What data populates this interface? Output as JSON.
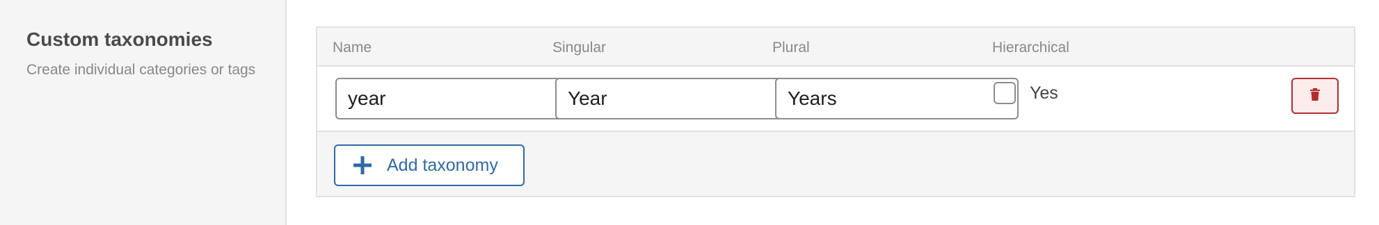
{
  "sidebar": {
    "title": "Custom taxonomies",
    "description": "Create individual categories or tags"
  },
  "table": {
    "headers": {
      "name": "Name",
      "singular": "Singular",
      "plural": "Plural",
      "hierarchical": "Hierarchical"
    },
    "rows": [
      {
        "name": "year",
        "singular": "Year",
        "plural": "Years",
        "hierarchical_label": "Yes",
        "hierarchical_checked": false
      }
    ]
  },
  "actions": {
    "add_label": "Add taxonomy",
    "delete_icon": "trash-icon",
    "add_icon": "plus-icon"
  },
  "colors": {
    "accent": "#2e6aa6",
    "danger": "#b32d2e",
    "danger_bg": "#fcecec"
  }
}
